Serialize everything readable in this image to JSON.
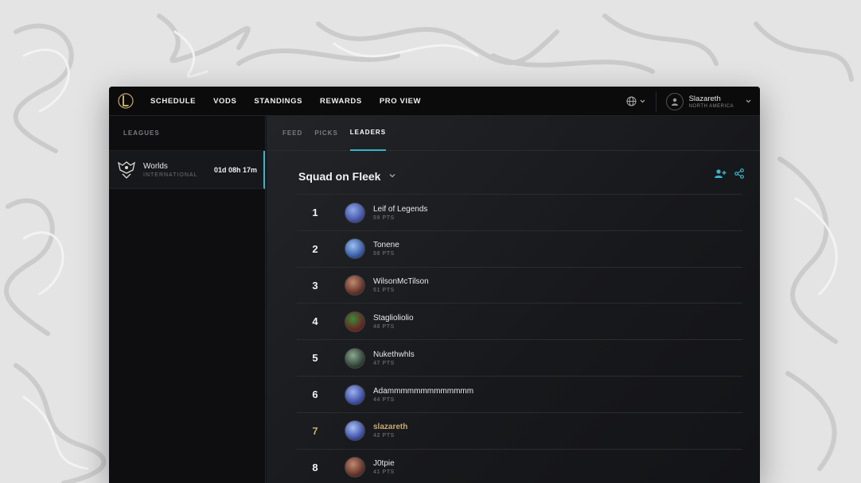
{
  "nav": {
    "items": [
      "SCHEDULE",
      "VODS",
      "STANDINGS",
      "REWARDS",
      "PRO VIEW"
    ]
  },
  "user": {
    "name": "Slazareth",
    "region": "NORTH AMERICA"
  },
  "sidebar": {
    "heading": "LEAGUES",
    "league": {
      "name": "Worlds",
      "sub": "INTERNATIONAL",
      "timer": "01d 08h 17m"
    }
  },
  "tabs": [
    {
      "label": "FEED",
      "active": false
    },
    {
      "label": "PICKS",
      "active": false
    },
    {
      "label": "LEADERS",
      "active": true
    }
  ],
  "squad": {
    "title": "Squad on Fleek"
  },
  "leaders": [
    {
      "rank": "1",
      "name": "Leif of Legends",
      "pts": "59 PTS",
      "me": false,
      "avatar": [
        "#3b4a9e",
        "#8fa8e8"
      ]
    },
    {
      "rank": "2",
      "name": "Tonene",
      "pts": "58 PTS",
      "me": false,
      "avatar": [
        "#2d4f9a",
        "#9cc0f0"
      ]
    },
    {
      "rank": "3",
      "name": "WilsonMcTilson",
      "pts": "51 PTS",
      "me": false,
      "avatar": [
        "#5a2a22",
        "#c08a70"
      ]
    },
    {
      "rank": "4",
      "name": "Staglioliolio",
      "pts": "48 PTS",
      "me": false,
      "avatar": [
        "#6a1e1e",
        "#3a8a3a"
      ]
    },
    {
      "rank": "5",
      "name": "Nukethwhls",
      "pts": "47 PTS",
      "me": false,
      "avatar": [
        "#2a3a30",
        "#8aa890"
      ]
    },
    {
      "rank": "6",
      "name": "Adammmmmmmmmmmmm",
      "pts": "44 PTS",
      "me": false,
      "avatar": [
        "#33449a",
        "#9cb0ee"
      ]
    },
    {
      "rank": "7",
      "name": "slazareth",
      "pts": "42 PTS",
      "me": true,
      "avatar": [
        "#33449a",
        "#a8c0f4"
      ]
    },
    {
      "rank": "8",
      "name": "J0tpie",
      "pts": "41 PTS",
      "me": false,
      "avatar": [
        "#5a2a22",
        "#c08a70"
      ]
    }
  ],
  "colors": {
    "accent": "#3ab3c7",
    "highlight": "#c8aa6e"
  },
  "icons": {
    "logo": "lol-logo-icon",
    "globe": "globe-icon",
    "user": "user-icon",
    "add_friend": "add-user-icon",
    "share": "share-icon",
    "worlds": "worlds-trophy-icon"
  }
}
